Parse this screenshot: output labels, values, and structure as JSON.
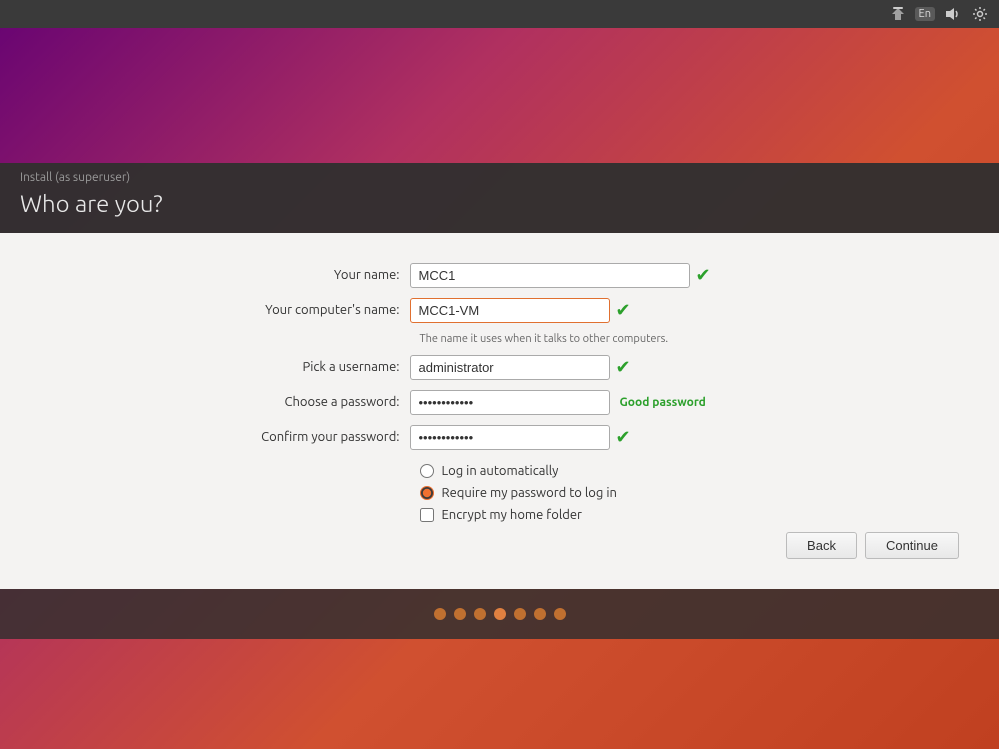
{
  "topbar": {
    "lang_badge": "En"
  },
  "installer": {
    "subtitle": "Install (as superuser)",
    "title": "Who are you?",
    "form": {
      "your_name_label": "Your name:",
      "your_name_value": "MCC1",
      "computer_name_label": "Your computer's name:",
      "computer_name_value": "MCC1-VM",
      "computer_name_hint": "The name it uses when it talks to other computers.",
      "username_label": "Pick a username:",
      "username_value": "administrator",
      "password_label": "Choose a password:",
      "password_value": "●●●●●●●●●●●",
      "password_strength": "Good password",
      "confirm_password_label": "Confirm your password:",
      "confirm_password_value": "●●●●●●●●●●●",
      "option_auto_login": "Log in automatically",
      "option_require_password": "Require my password to log in",
      "option_encrypt": "Encrypt my home folder"
    },
    "buttons": {
      "back": "Back",
      "continue": "Continue"
    },
    "progress_dots": [
      1,
      2,
      3,
      4,
      5,
      6,
      7
    ]
  }
}
